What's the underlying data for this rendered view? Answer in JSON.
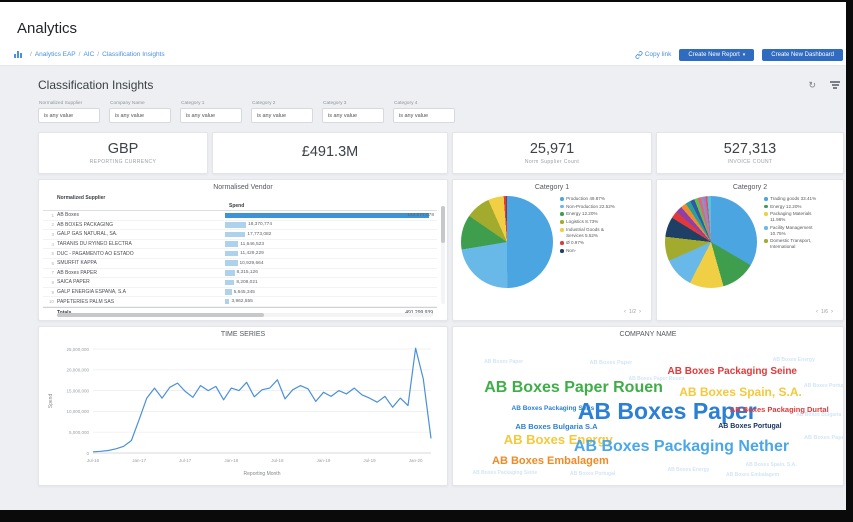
{
  "app": {
    "title": "Analytics"
  },
  "breadcrumb": {
    "items": [
      "Analytics EAP",
      "AIC",
      "Classification Insights"
    ]
  },
  "toolbar": {
    "copy_link": "Copy link",
    "create_report": "Create New Report",
    "create_dashboard": "Create New Dashboard"
  },
  "dashboard": {
    "title": "Classification Insights"
  },
  "filters": [
    {
      "label": "Normalized Supplier",
      "value": "is any value"
    },
    {
      "label": "Company Name",
      "value": "is any value"
    },
    {
      "label": "Category 1",
      "value": "is any value"
    },
    {
      "label": "Category 2",
      "value": "is any value"
    },
    {
      "label": "Category 3",
      "value": "is any value"
    },
    {
      "label": "Category 4",
      "value": "is any value"
    }
  ],
  "kpis": [
    {
      "value": "GBP",
      "label": "REPORTING CURRENCY"
    },
    {
      "value": "£491.3M",
      "label": ""
    },
    {
      "value": "25,971",
      "label": "Norm Supplier Count"
    },
    {
      "value": "527,313",
      "label": "INVOICE COUNT"
    }
  ],
  "vendor_table": {
    "title": "Normalised Vendor",
    "col_supplier": "Normalized Supplier",
    "col_spend": "Spend",
    "rows": [
      {
        "name": "AB Boxes",
        "value": "144,077,078",
        "num": 144077078
      },
      {
        "name": "AB BOXES PACKAGING",
        "value": "18,370,774",
        "num": 18370774
      },
      {
        "name": "GALP GÁS NATURAL, SA.",
        "value": "17,773,082",
        "num": 17773082
      },
      {
        "name": "TARANIS DU RYINEO ELECTRA",
        "value": "11,646,523",
        "num": 11646523
      },
      {
        "name": "DUC - PAGAMENTO AO ESTADO",
        "value": "11,429,229",
        "num": 11429229
      },
      {
        "name": "SMURFIT KAPPA",
        "value": "10,929,664",
        "num": 10929664
      },
      {
        "name": "AB Boxes PAPER",
        "value": "8,315,126",
        "num": 8315126
      },
      {
        "name": "SAICA PAPER",
        "value": "8,208,021",
        "num": 8208021
      },
      {
        "name": "GALP ENERGIA ESPAÑA, S.A",
        "value": "5,645,345",
        "num": 5645345
      },
      {
        "name": "PAPETERIES PALM SAS",
        "value": "3,962,555",
        "num": 3962555
      }
    ],
    "totals_label": "Totals",
    "totals_value": "491,299,939"
  },
  "chart_data": [
    {
      "type": "pie",
      "title": "Category 1",
      "pagination": "1/2",
      "legend_position": "right",
      "slices": [
        {
          "label": "Production",
          "text": "49.87%",
          "pct": 49.87,
          "color": "#4aa5e0"
        },
        {
          "label": "Non-Production",
          "text": "22.52%",
          "pct": 22.52,
          "color": "#68b9e8"
        },
        {
          "label": "Energy",
          "text": "12.20%",
          "pct": 12.2,
          "color": "#3f9e4d"
        },
        {
          "label": "Logistics",
          "text": "8.73%",
          "pct": 8.73,
          "color": "#a2ab2e"
        },
        {
          "label": "Industrial Goods & Services",
          "text": "5.52%",
          "pct": 5.52,
          "color": "#f0cf45"
        },
        {
          "label": "Ø",
          "text": "0.97%",
          "pct": 0.97,
          "color": "#e0393b"
        },
        {
          "label": "Non-",
          "text": "",
          "pct": 0.19,
          "color": "#1e3f66"
        }
      ]
    },
    {
      "type": "pie",
      "title": "Category 2",
      "pagination": "1/6",
      "legend_position": "right",
      "slices": [
        {
          "label": "Trading goods",
          "text": "33.41%",
          "pct": 33.41,
          "color": "#4aa5e0"
        },
        {
          "label": "Energy",
          "text": "12.20%",
          "pct": 12.2,
          "color": "#3f9e4d"
        },
        {
          "label": "Packaging Materials",
          "text": "11.96%",
          "pct": 11.96,
          "color": "#f0cf45"
        },
        {
          "label": "Facility Management",
          "text": "10.75%",
          "pct": 10.75,
          "color": "#68b9e8"
        },
        {
          "label": "Domestic Transport, International",
          "text": "",
          "pct": 8.53,
          "color": "#a2ab2e"
        },
        {
          "label": "",
          "text": "",
          "pct": 7.0,
          "color": "#1e3f66"
        },
        {
          "label": "",
          "text": "",
          "pct": 2.6,
          "color": "#e0393b"
        },
        {
          "label": "",
          "text": "",
          "pct": 2.3,
          "color": "#8e3fa8"
        },
        {
          "label": "",
          "text": "",
          "pct": 2.0,
          "color": "#ef8c2f"
        },
        {
          "label": "",
          "text": "",
          "pct": 1.8,
          "color": "#2aa198"
        },
        {
          "label": "",
          "text": "",
          "pct": 1.5,
          "color": "#3355aa"
        },
        {
          "label": "",
          "text": "",
          "pct": 1.3,
          "color": "#6abf4b"
        },
        {
          "label": "",
          "text": "",
          "pct": 1.1,
          "color": "#e06090"
        },
        {
          "label": "",
          "text": "",
          "pct": 0.9,
          "color": "#8899aa"
        },
        {
          "label": "",
          "text": "",
          "pct": 0.75,
          "color": "#b86fce"
        },
        {
          "label": "",
          "text": "",
          "pct": 0.6,
          "color": "#d9534f"
        },
        {
          "label": "",
          "text": "",
          "pct": 1.3,
          "color": "#5bc0de"
        }
      ]
    },
    {
      "type": "line",
      "title": "TIME SERIES",
      "xlabel": "Reporting Month",
      "ylabel": "Spend",
      "ylim": [
        0,
        25000000
      ],
      "yticks": [
        0,
        5000000,
        10000000,
        15000000,
        20000000,
        25000000
      ],
      "x_tick_labels": [
        "Jul-16",
        "Jan-17",
        "Jul-17",
        "Jan-18",
        "Jul-18",
        "Jan-19",
        "Jul-19",
        "Jan-20"
      ],
      "x_tick_positions": [
        0,
        6,
        12,
        18,
        24,
        30,
        36,
        42
      ],
      "line_color": "#4a90d9",
      "grid": true,
      "values": [
        300000,
        400000,
        600000,
        1000000,
        1600000,
        3000000,
        8000000,
        13200000,
        15600000,
        13200000,
        15800000,
        16800000,
        14800000,
        13400000,
        16200000,
        15000000,
        16000000,
        12800000,
        15600000,
        15000000,
        17000000,
        13500000,
        15200000,
        15600000,
        17600000,
        13000000,
        15200000,
        16200000,
        15400000,
        12400000,
        14600000,
        13600000,
        15000000,
        14200000,
        15600000,
        14000000,
        13200000,
        12200000,
        13600000,
        11000000,
        13200000,
        11400000,
        25200000,
        17800000,
        3500000
      ]
    },
    {
      "type": "wordcloud",
      "title": "COMPANY NAME",
      "words": [
        {
          "text": "AB Boxes Packaging Seine",
          "color": "#e03a3a",
          "size": 10,
          "x": 55,
          "y": 18,
          "faint": false
        },
        {
          "text": "AB Boxes Paper Rouen",
          "color": "#3fae49",
          "size": 16,
          "x": 8,
          "y": 27,
          "faint": false
        },
        {
          "text": "AB Boxes Spain, S.A.",
          "color": "#f5c93a",
          "size": 12,
          "x": 58,
          "y": 31,
          "faint": false
        },
        {
          "text": "AB Boxes Packaging Seris",
          "color": "#2b7fd4",
          "size": 6.5,
          "x": 15,
          "y": 45,
          "faint": false
        },
        {
          "text": "AB Boxes Paper",
          "color": "#2b7fd4",
          "size": 23,
          "x": 32,
          "y": 41,
          "faint": false
        },
        {
          "text": "AB Boxes Packaging Durtal",
          "color": "#e03a3a",
          "size": 7.5,
          "x": 71,
          "y": 45,
          "faint": false
        },
        {
          "text": "AB Boxes Bulgaria S.A",
          "color": "#2b7fd4",
          "size": 7.5,
          "x": 16,
          "y": 57,
          "faint": false
        },
        {
          "text": "AB Boxes Portugal",
          "color": "#16325c",
          "size": 7,
          "x": 68,
          "y": 57,
          "faint": false
        },
        {
          "text": "AB Boxes Energy",
          "color": "#f5c93a",
          "size": 13,
          "x": 13,
          "y": 64,
          "faint": false
        },
        {
          "text": "AB Boxes Packaging Nether",
          "color": "#4aa7e8",
          "size": 16,
          "x": 31,
          "y": 68,
          "faint": false
        },
        {
          "text": "AB Boxes Embalagem",
          "color": "#f08a24",
          "size": 11,
          "x": 10,
          "y": 80,
          "faint": false
        },
        {
          "text": "AB Boxes Paper",
          "color": "#8fbfe4",
          "size": 5.5,
          "x": 35,
          "y": 14,
          "faint": true
        },
        {
          "text": "AB Boxes Energy",
          "color": "#8fbfe4",
          "size": 5,
          "x": 82,
          "y": 12,
          "faint": true
        },
        {
          "text": "AB Boxes Portugal",
          "color": "#8fbfe4",
          "size": 5,
          "x": 90,
          "y": 30,
          "faint": true
        },
        {
          "text": "AB Boxes Paper Rouen",
          "color": "#8fbfe4",
          "size": 5,
          "x": 45,
          "y": 25,
          "faint": true
        },
        {
          "text": "AB Boxes Bulgaria S.A",
          "color": "#8fbfe4",
          "size": 5,
          "x": 88,
          "y": 50,
          "faint": true
        },
        {
          "text": "AB Boxes Paper",
          "color": "#8fbfe4",
          "size": 5.5,
          "x": 90,
          "y": 66,
          "faint": true
        },
        {
          "text": "AB Boxes Energy",
          "color": "#8fbfe4",
          "size": 5,
          "x": 55,
          "y": 88,
          "faint": true
        },
        {
          "text": "AB Boxes Portugal",
          "color": "#8fbfe4",
          "size": 5,
          "x": 30,
          "y": 91,
          "faint": true
        },
        {
          "text": "AB Boxes Spain, S.A.",
          "color": "#8fbfe4",
          "size": 5,
          "x": 75,
          "y": 85,
          "faint": true
        },
        {
          "text": "AB Boxes Paper",
          "color": "#8fbfe4",
          "size": 5,
          "x": 8,
          "y": 13,
          "faint": true
        },
        {
          "text": "AB Boxes Embalagem",
          "color": "#8fbfe4",
          "size": 5,
          "x": 70,
          "y": 92,
          "faint": true
        },
        {
          "text": "AB Boxes Packaging Seine",
          "color": "#8fbfe4",
          "size": 5,
          "x": 5,
          "y": 90,
          "faint": true
        }
      ]
    }
  ]
}
